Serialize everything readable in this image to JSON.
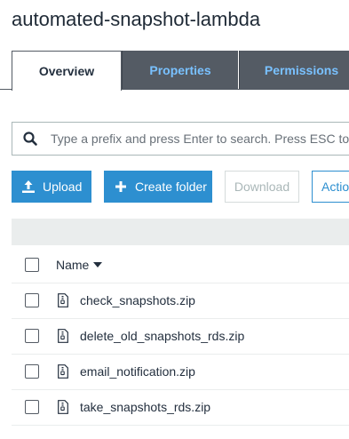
{
  "bucket": {
    "title": "automated-snapshot-lambda"
  },
  "tabs": [
    {
      "label": "Overview",
      "active": true
    },
    {
      "label": "Properties",
      "active": false
    },
    {
      "label": "Permissions",
      "active": false
    }
  ],
  "search": {
    "icon": "search-icon",
    "placeholder": "Type a prefix and press Enter to search. Press ESC to clear.",
    "value": ""
  },
  "toolbar": {
    "upload_label": "Upload",
    "upload_icon": "upload-icon",
    "create_folder_label": "Create folder",
    "create_folder_icon": "plus-icon",
    "download_label": "Download",
    "actions_label": "Actions"
  },
  "table": {
    "header": {
      "name_label": "Name",
      "sort_icon": "caret-down-icon"
    },
    "files": [
      {
        "name": "check_snapshots.zip",
        "icon": "zip-file-icon"
      },
      {
        "name": "delete_old_snapshots_rds.zip",
        "icon": "zip-file-icon"
      },
      {
        "name": "email_notification.zip",
        "icon": "zip-file-icon"
      },
      {
        "name": "take_snapshots_rds.zip",
        "icon": "zip-file-icon"
      }
    ]
  },
  "colors": {
    "primary_button": "#2d8fd0",
    "tab_inactive_bg": "#545b64",
    "tab_inactive_text": "#79c1ff",
    "text": "#232f3e",
    "divider": "#eaeded"
  }
}
